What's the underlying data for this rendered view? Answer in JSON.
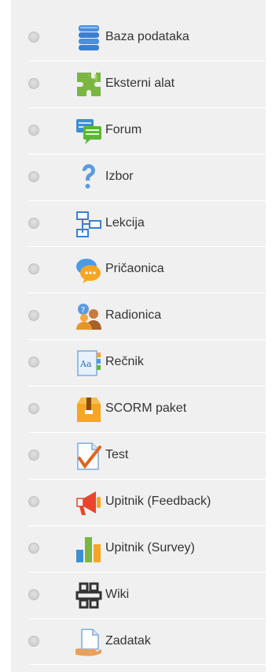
{
  "activities": [
    {
      "label": "Baza podataka",
      "icon": "database-icon"
    },
    {
      "label": "Eksterni alat",
      "icon": "puzzle-icon"
    },
    {
      "label": "Forum",
      "icon": "forum-icon"
    },
    {
      "label": "Izbor",
      "icon": "question-icon"
    },
    {
      "label": "Lekcija",
      "icon": "lesson-icon"
    },
    {
      "label": "Pričaonica",
      "icon": "chat-icon"
    },
    {
      "label": "Radionica",
      "icon": "workshop-icon"
    },
    {
      "label": "Rečnik",
      "icon": "glossary-icon"
    },
    {
      "label": "SCORM paket",
      "icon": "scorm-icon"
    },
    {
      "label": "Test",
      "icon": "quiz-icon"
    },
    {
      "label": "Upitnik (Feedback)",
      "icon": "megaphone-icon"
    },
    {
      "label": "Upitnik (Survey)",
      "icon": "survey-chart-icon"
    },
    {
      "label": "Wiki",
      "icon": "wiki-icon"
    },
    {
      "label": "Zadatak",
      "icon": "assignment-icon"
    }
  ]
}
